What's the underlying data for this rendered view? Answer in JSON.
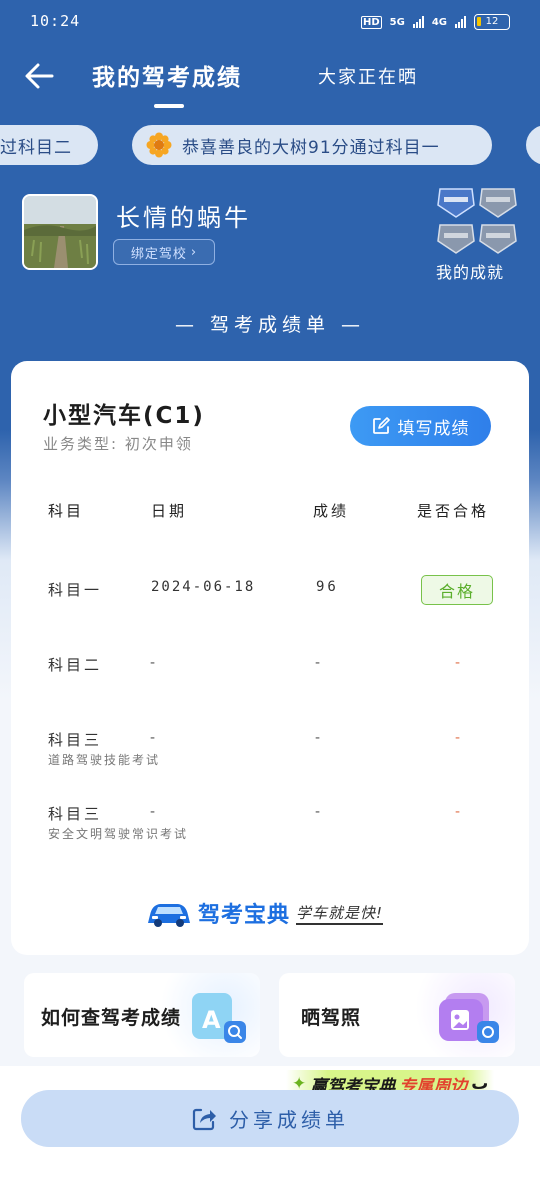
{
  "status": {
    "time": "10:24",
    "hd": "HD",
    "net1": "5G",
    "net2": "4G",
    "battery": "12"
  },
  "nav": {
    "title": "我的驾考成绩",
    "tab2": "大家正在晒"
  },
  "ticker": {
    "left": "过科目二",
    "mid": "恭喜善良的大树91分通过科目一"
  },
  "user": {
    "name": "长情的蜗牛",
    "bind": "绑定驾校",
    "achievements": "我的成就"
  },
  "section_title": "— 驾考成绩单 —",
  "card": {
    "car_type": "小型汽车(C1)",
    "business": "业务类型: 初次申领",
    "fill_button": "填写成绩",
    "headers": {
      "subject": "科目",
      "date": "日期",
      "score": "成绩",
      "passed": "是否合格"
    },
    "rows": [
      {
        "subject": "科目一",
        "sub": "",
        "date": "2024-06-18",
        "score": "96",
        "result": "合格"
      },
      {
        "subject": "科目二",
        "sub": "",
        "date": "-",
        "score": "-",
        "result": "-"
      },
      {
        "subject": "科目三",
        "sub": "道路驾驶技能考试",
        "date": "-",
        "score": "-",
        "result": "-"
      },
      {
        "subject": "科目三",
        "sub": "安全文明驾驶常识考试",
        "date": "-",
        "score": "-",
        "result": "-"
      }
    ],
    "brand": "驾考宝典",
    "slogan": "学车就是快!"
  },
  "tiles": {
    "query": "如何查驾考成绩",
    "license": "晒驾照"
  },
  "promo": {
    "a": "赢驾考宝典",
    "b": "专属周边"
  },
  "share": "分享成绩单",
  "colors": {
    "primary": "#2e63ad",
    "accent": "#3d9af4",
    "pass": "#78c24a"
  }
}
